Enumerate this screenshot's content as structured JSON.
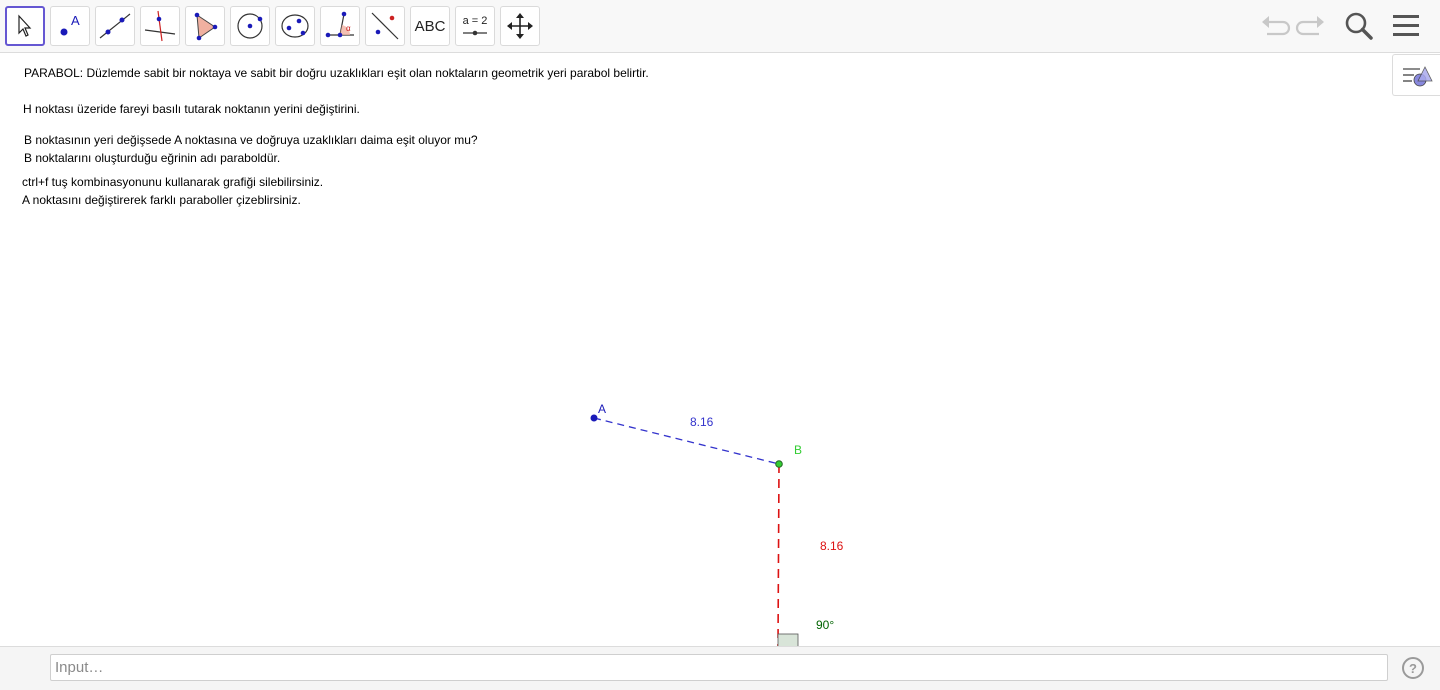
{
  "toolbar": {
    "tools": [
      {
        "name": "move-tool",
        "icon": "cursor-arrow-icon",
        "active": true
      },
      {
        "name": "point-tool",
        "icon": "point-icon",
        "label": "A"
      },
      {
        "name": "line-tool",
        "icon": "line-icon"
      },
      {
        "name": "perpendicular-tool",
        "icon": "perpendicular-line-icon"
      },
      {
        "name": "polygon-tool",
        "icon": "polygon-icon"
      },
      {
        "name": "circle-tool",
        "icon": "circle-center-point-icon"
      },
      {
        "name": "ellipse-tool",
        "icon": "ellipse-icon"
      },
      {
        "name": "angle-tool",
        "icon": "angle-icon",
        "label": "α"
      },
      {
        "name": "reflect-tool",
        "icon": "reflect-line-icon"
      },
      {
        "name": "text-tool",
        "icon": "text-icon",
        "label": "ABC"
      },
      {
        "name": "slider-tool",
        "icon": "slider-icon",
        "label": "a = 2"
      },
      {
        "name": "move-graphics-tool",
        "icon": "move-arrows-icon"
      }
    ],
    "right": [
      "undo-icon",
      "redo-icon",
      "search-icon",
      "menu-icon"
    ]
  },
  "canvas": {
    "texts": {
      "t1": "PARABOL: Düzlemde sabit bir noktaya ve sabit bir doğru uzaklıkları eşit olan noktaların geometrik yeri parabol belirtir.",
      "t2": "H noktası üzeride fareyi basılı tutarak noktanın yerini değiştirini.",
      "t3": "B noktasının yeri değişsede A noktasına ve doğruya uzaklıkları daima eşit oluyor mu?",
      "t4": "B noktalarını oluşturduğu eğrinin adı paraboldür.",
      "t5": "ctrl+f tuş kombinasyonunu kullanarak grafiği silebilirsiniz.",
      "t6": "A noktasını değiştirerek farklı paraboller çizeblirsiniz."
    },
    "labels": {
      "point_a": "A",
      "point_b": "B",
      "dist_ab": "8.16",
      "dist_b_line": "8.16",
      "angle": "90°"
    },
    "colors": {
      "point_a": "#1a1ab8",
      "segment_ab": "#3333cc",
      "point_b": "#33cc33",
      "segment_b_line": "#dd1111",
      "angle_label": "#006400",
      "accent": "#6557d2"
    }
  },
  "input": {
    "placeholder": "Input…",
    "help": "?"
  }
}
